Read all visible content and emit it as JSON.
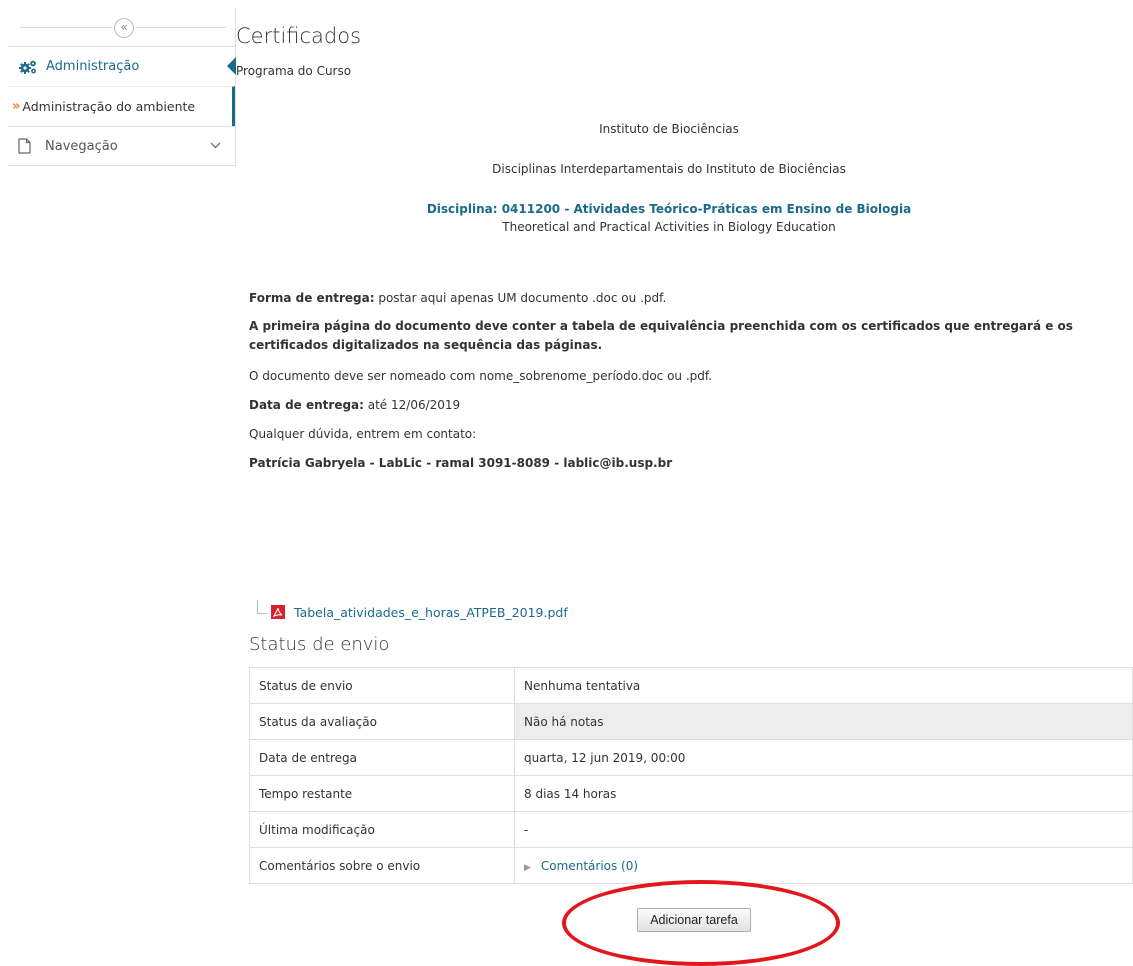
{
  "sidebar": {
    "collapse_icon": "«",
    "admin_label": "Administração",
    "admin_env_label": "Administração do ambiente",
    "nav_label": "Navegação",
    "accent_color": "#1a6a8c"
  },
  "header": {
    "title": "Certificados",
    "subtitle": "Programa do Curso"
  },
  "content": {
    "institute": "Instituto de Biociências",
    "disciplines": "Disciplinas Interdepartamentais do Instituto de Biociências",
    "course": "Disciplina: 0411200 - Atividades Teórico-Práticas em Ensino de Biologia",
    "course_en": "Theoretical and Practical Activities in Biology Education",
    "delivery_label": "Forma de entrega:",
    "delivery_text": " postar aqui apenas UM documento .doc ou .pdf.",
    "first_page": "A primeira página do documento deve conter a tabela de equivalência preenchida com os certificados que entregará e os certificados digitalizados na sequência das páginas.",
    "naming": "O documento deve ser nomeado com nome_sobrenome_período.doc ou .pdf.",
    "date_label": "Data de entrega:",
    "date_text": " até 12/06/2019",
    "questions": "Qualquer dúvida, entrem em contato:",
    "contact": "Patrícia Gabryela - LabLic - ramal 3091-8089 - lablic@ib.usp.br",
    "file_name": "Tabela_atividades_e_horas_ATPEB_2019.pdf"
  },
  "status": {
    "title": "Status de envio",
    "rows": [
      {
        "label": "Status de envio",
        "value": "Nenhuma tentativa"
      },
      {
        "label": "Status da avaliação",
        "value": "Não há notas"
      },
      {
        "label": "Data de entrega",
        "value": "quarta, 12 jun 2019, 00:00"
      },
      {
        "label": "Tempo restante",
        "value": "8 dias 14 horas"
      },
      {
        "label": "Última modificação",
        "value": "-"
      },
      {
        "label": "Comentários sobre o envio",
        "value": "Comentários (0)"
      }
    ]
  },
  "actions": {
    "add_submission": "Adicionar tarefa"
  },
  "colors": {
    "highlight_ellipse": "#e3161b",
    "link": "#1a6a8c"
  }
}
